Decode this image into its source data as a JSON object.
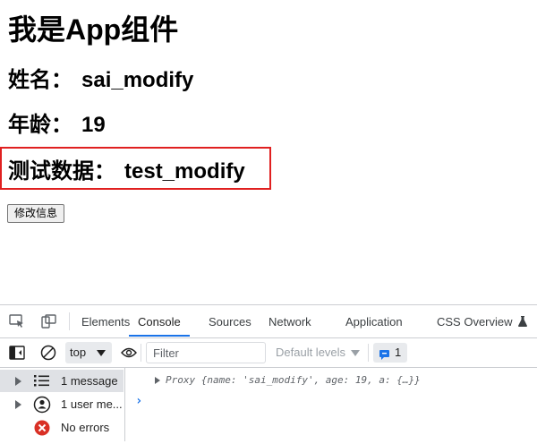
{
  "app": {
    "title": "我是App组件",
    "name_label": "姓名：",
    "name_value": "sai_modify",
    "age_label": "年龄：",
    "age_value": "19",
    "test_label": "测试数据：",
    "test_value": "test_modify",
    "button_label": "修改信息",
    "highlight_color": "#e02020"
  },
  "devtools": {
    "tabs": [
      "Elements",
      "Console",
      "Sources",
      "Network",
      "Application",
      "CSS Overview"
    ],
    "active_tab": "Console",
    "context": "top",
    "filter_placeholder": "Filter",
    "levels": "Default levels",
    "issues_count": "1",
    "sidebar": [
      {
        "label": "1 message",
        "icon": "list-icon"
      },
      {
        "label": "1 user me...",
        "icon": "user-icon"
      },
      {
        "label": "No errors",
        "icon": "error-icon"
      }
    ],
    "log": "Proxy {name: 'sai_modify', age: 19, a: {…}}",
    "accent": "#1a73e8"
  }
}
